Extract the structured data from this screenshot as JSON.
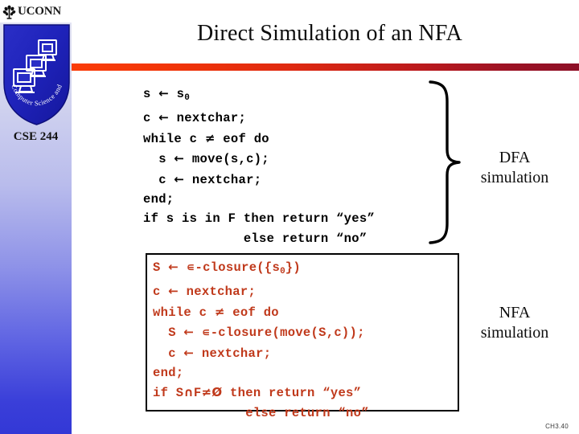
{
  "branding": {
    "university": "UCONN",
    "crest_icon": "oak-tree-crest-icon",
    "shield_icon": "cse-shield-logo-icon",
    "shield_motto": "Computer Science and Engineering",
    "course": "CSE 244",
    "sidebar_gradient_top": "#e2e3f3",
    "sidebar_gradient_bottom": "#3338d6"
  },
  "header": {
    "title": "Direct Simulation of an NFA",
    "rule_gradient_start": "#fa3c09",
    "rule_gradient_end": "#8d0f26"
  },
  "dfa_block": {
    "color": "#000000",
    "lines": [
      "s ← s₀",
      "c ← nextchar;",
      "while c ≠ eof do",
      "   s ← move(s,c);",
      "   c ← nextchar;",
      "end;",
      "if s is in F then return “yes”",
      "             else return “no”"
    ],
    "label": "DFA\nsimulation",
    "label_line1": "DFA",
    "label_line2": "simulation",
    "brace_icon": "right-curly-brace-icon"
  },
  "nfa_block": {
    "color": "#c0391b",
    "border_color": "#000000",
    "lines": [
      "S ← ∊-closure({s₀})",
      "c ← nextchar;",
      "while c ≠ eof do",
      "   S ← ∊-closure(move(S,c));",
      "   c ← nextchar;",
      "end;",
      "if S∩F≠Ø then return “yes”",
      "            else return “no”"
    ],
    "label_line1": "NFA",
    "label_line2": "simulation"
  },
  "footer": {
    "slide_ref": "CH3.40"
  }
}
